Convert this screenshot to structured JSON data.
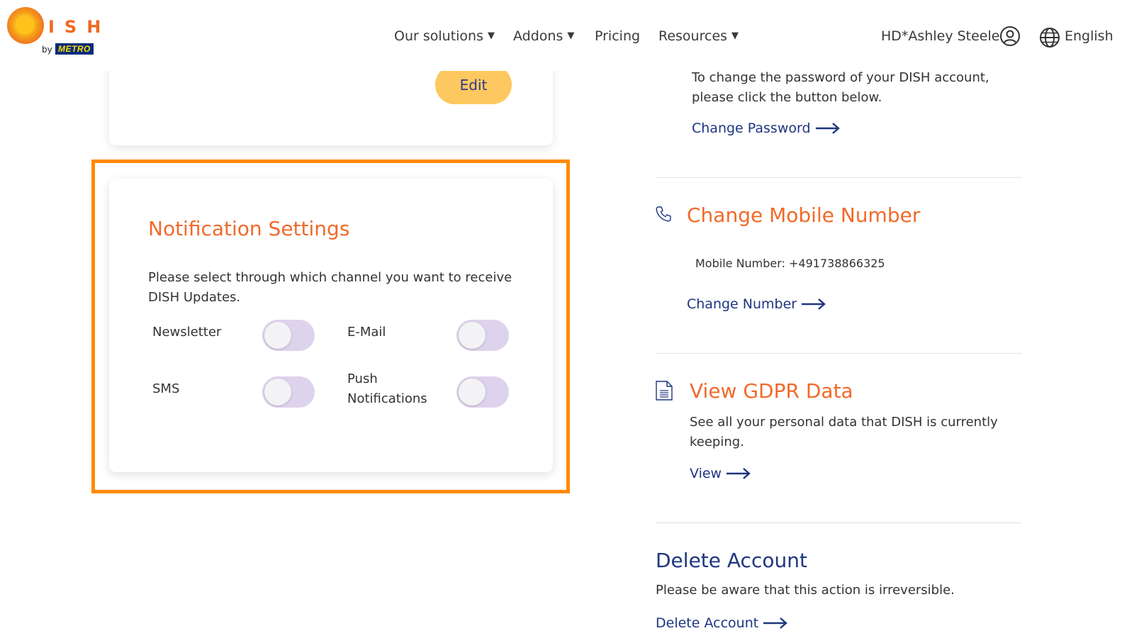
{
  "header": {
    "logo_letters": "ISH",
    "logo_by": "by",
    "logo_metro": "METRO",
    "nav": [
      {
        "label": "Our solutions",
        "has_caret": true
      },
      {
        "label": "Addons",
        "has_caret": true
      },
      {
        "label": "Pricing",
        "has_caret": false
      },
      {
        "label": "Resources",
        "has_caret": true
      }
    ],
    "caret": "▼",
    "user_name": "HD*Ashley Steele",
    "language": "English"
  },
  "profile_card": {
    "edit_label": "Edit"
  },
  "notifications": {
    "title": "Notification Settings",
    "description": "Please select through which channel you want to receive DISH Updates.",
    "options": [
      {
        "label": "Newsletter",
        "enabled": false
      },
      {
        "label": "E-Mail",
        "enabled": false
      },
      {
        "label": "SMS",
        "enabled": false
      },
      {
        "label": "Push Notifications",
        "enabled": false
      }
    ]
  },
  "password": {
    "text": "To change the password of your DISH account, please click the button below.",
    "link": "Change Password"
  },
  "mobile": {
    "title": "Change Mobile Number",
    "number_line": "Mobile Number: +491738866325",
    "link": "Change Number"
  },
  "gdpr": {
    "title": "View GDPR Data",
    "text": "See all your personal data that DISH is currently keeping.",
    "link": "View"
  },
  "delete": {
    "title": "Delete Account",
    "text": "Please be aware that this action is irreversible.",
    "link": "Delete Account"
  },
  "colors": {
    "accent_orange": "#f06a2a",
    "link_blue": "#1e3580",
    "edit_button": "#fdc85f",
    "highlight": "#ff8a00",
    "toggle_off": "#ddd3ec"
  }
}
